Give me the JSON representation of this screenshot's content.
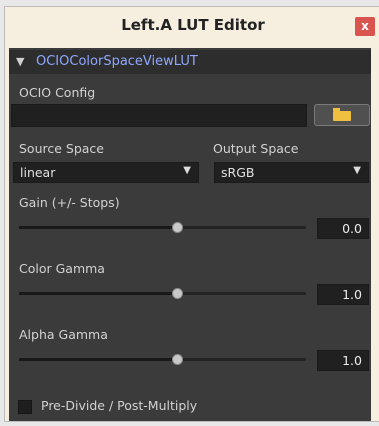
{
  "window": {
    "title": "Left.A LUT Editor",
    "close_label": "x"
  },
  "section": {
    "title": "OCIOColorSpaceViewLUT",
    "expand_icon": "chevron-down-icon"
  },
  "ocio_config": {
    "label": "OCIO Config",
    "value": "",
    "browse_icon": "folder-icon"
  },
  "source_space": {
    "label": "Source Space",
    "value": "linear"
  },
  "output_space": {
    "label": "Output Space",
    "value": "sRGB"
  },
  "gain": {
    "label": "Gain (+/- Stops)",
    "value": "0.0",
    "slider_fraction": 0.55
  },
  "color_gamma": {
    "label": "Color Gamma",
    "value": "1.0",
    "slider_fraction": 0.55
  },
  "alpha_gamma": {
    "label": "Alpha Gamma",
    "value": "1.0",
    "slider_fraction": 0.55
  },
  "predivide": {
    "label": "Pre-Divide / Post-Multiply",
    "checked": false
  },
  "colors": {
    "panel_bg": "#3b3b3b",
    "header_bg": "#2d2d2d",
    "section_title": "#8fa8ff",
    "close_button": "#d9534f",
    "folder_icon": "#f0c040"
  }
}
